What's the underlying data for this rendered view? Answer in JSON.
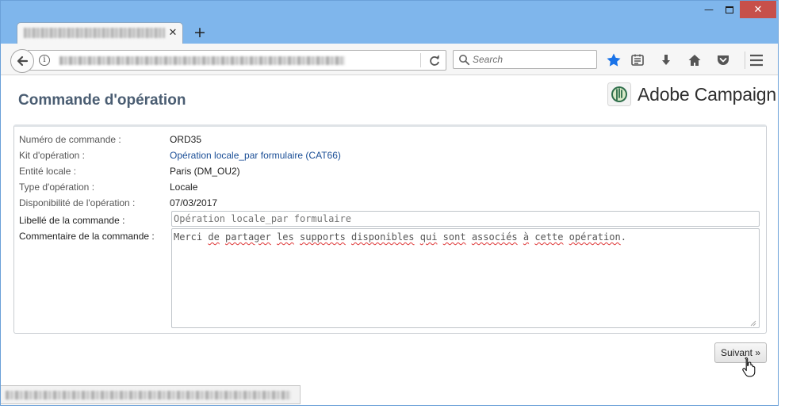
{
  "browser": {
    "window_controls": {
      "minimize": "—",
      "close": "✕"
    },
    "tab": {
      "close_glyph": "✕",
      "new_tab_glyph": "+"
    },
    "search": {
      "placeholder": "Search"
    },
    "toolbar_icons": [
      "back-arrow-icon",
      "info-icon",
      "reload-icon",
      "search-icon",
      "bookmark-star-icon",
      "reading-list-icon",
      "download-icon",
      "home-icon",
      "pocket-icon",
      "menu-icon"
    ],
    "colors": {
      "titlebar": "#7fb6ec",
      "close_button": "#c7504a",
      "star": "#1a73e8"
    }
  },
  "page": {
    "title": "Commande d'opération",
    "brand": "Adobe Campaign",
    "fields": {
      "order_number": {
        "label": "Numéro de commande :",
        "value": "ORD35"
      },
      "operation_kit": {
        "label": "Kit d'opération :",
        "value": "Opération locale_par formulaire (CAT66)"
      },
      "local_entity": {
        "label": "Entité locale :",
        "value": "Paris (DM_OU2)"
      },
      "operation_type": {
        "label": "Type d'opération :",
        "value": "Locale"
      },
      "availability": {
        "label": "Disponibilité de l'opération :",
        "value": "07/03/2017"
      },
      "order_label": {
        "label": "Libellé de la commande :",
        "placeholder": "Opération locale_par formulaire"
      },
      "order_comment": {
        "label": "Commentaire de la commande :",
        "words": [
          "Merci",
          " ",
          "de",
          " ",
          "partager",
          " ",
          "les",
          " ",
          "supports",
          " ",
          "disponibles",
          " ",
          "qui",
          " ",
          "sont",
          " ",
          "associés",
          " ",
          "à",
          " ",
          "cette",
          " ",
          "opération",
          "."
        ]
      }
    },
    "next_button": "Suivant »",
    "colors": {
      "title": "#4a5d72",
      "link": "#1a4e96"
    }
  }
}
